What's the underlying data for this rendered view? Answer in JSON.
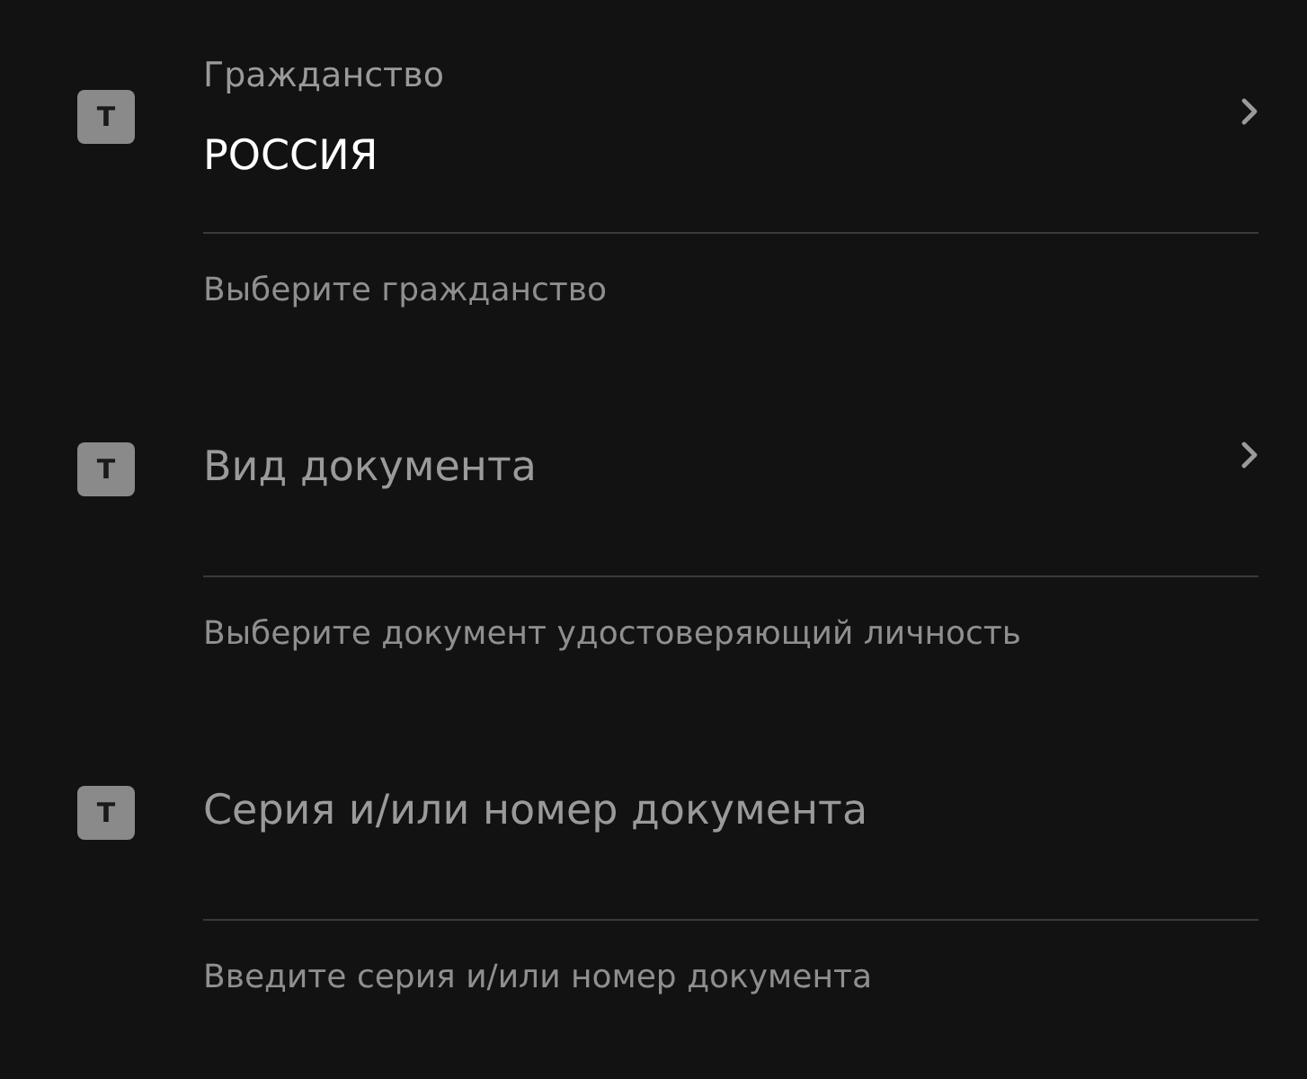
{
  "fields": [
    {
      "kind": "select",
      "badge": "T",
      "label": "Гражданство",
      "value": "РОССИЯ",
      "helper": "Выберите гражданство"
    },
    {
      "kind": "select",
      "badge": "T",
      "placeholder": "Вид документа",
      "helper": "Выберите документ удостоверяющий личность"
    },
    {
      "kind": "text",
      "badge": "T",
      "placeholder": "Серия и/или номер документа",
      "helper": "Введите серия и/или номер документа"
    }
  ]
}
